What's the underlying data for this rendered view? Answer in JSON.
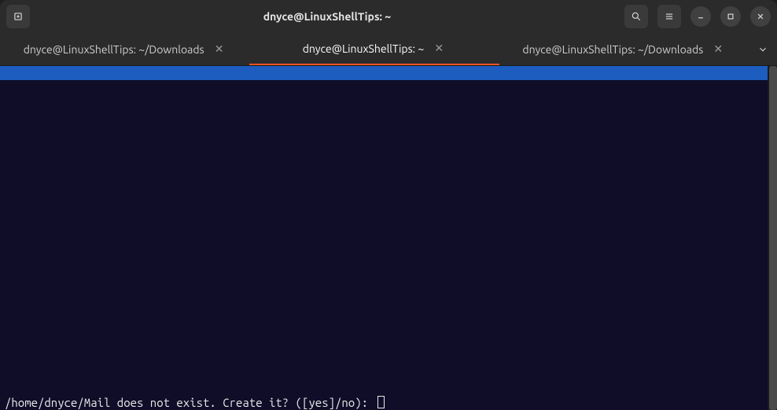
{
  "titlebar": {
    "title": "dnyce@LinuxShellTips: ~"
  },
  "tabs": [
    {
      "label": "dnyce@LinuxShellTips: ~/Downloads",
      "active": false
    },
    {
      "label": "dnyce@LinuxShellTips: ~",
      "active": true
    },
    {
      "label": "dnyce@LinuxShellTips: ~/Downloads",
      "active": false
    }
  ],
  "terminal": {
    "prompt": "/home/dnyce/Mail does not exist. Create it? ([yes]/no): "
  }
}
